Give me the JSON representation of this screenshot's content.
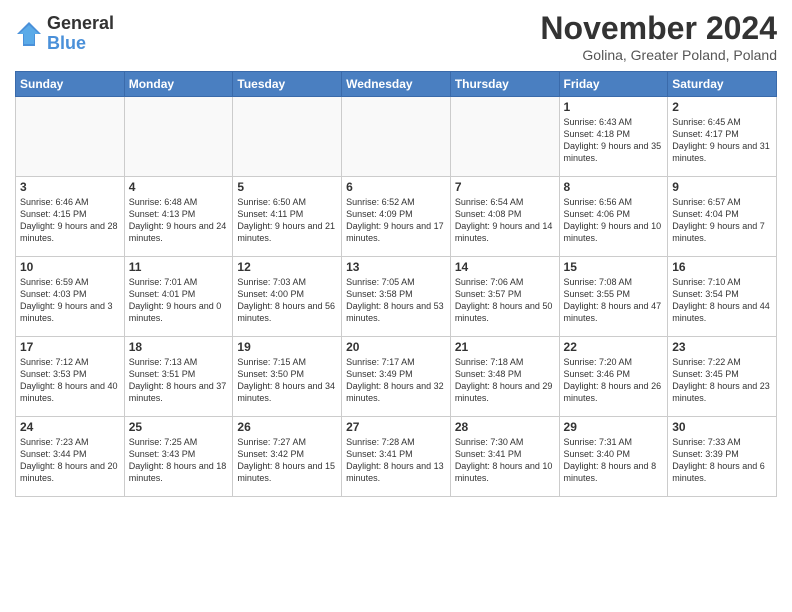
{
  "logo": {
    "general": "General",
    "blue": "Blue"
  },
  "title": "November 2024",
  "subtitle": "Golina, Greater Poland, Poland",
  "days_header": [
    "Sunday",
    "Monday",
    "Tuesday",
    "Wednesday",
    "Thursday",
    "Friday",
    "Saturday"
  ],
  "weeks": [
    [
      {
        "num": "",
        "info": ""
      },
      {
        "num": "",
        "info": ""
      },
      {
        "num": "",
        "info": ""
      },
      {
        "num": "",
        "info": ""
      },
      {
        "num": "",
        "info": ""
      },
      {
        "num": "1",
        "info": "Sunrise: 6:43 AM\nSunset: 4:18 PM\nDaylight: 9 hours\nand 35 minutes."
      },
      {
        "num": "2",
        "info": "Sunrise: 6:45 AM\nSunset: 4:17 PM\nDaylight: 9 hours\nand 31 minutes."
      }
    ],
    [
      {
        "num": "3",
        "info": "Sunrise: 6:46 AM\nSunset: 4:15 PM\nDaylight: 9 hours\nand 28 minutes."
      },
      {
        "num": "4",
        "info": "Sunrise: 6:48 AM\nSunset: 4:13 PM\nDaylight: 9 hours\nand 24 minutes."
      },
      {
        "num": "5",
        "info": "Sunrise: 6:50 AM\nSunset: 4:11 PM\nDaylight: 9 hours\nand 21 minutes."
      },
      {
        "num": "6",
        "info": "Sunrise: 6:52 AM\nSunset: 4:09 PM\nDaylight: 9 hours\nand 17 minutes."
      },
      {
        "num": "7",
        "info": "Sunrise: 6:54 AM\nSunset: 4:08 PM\nDaylight: 9 hours\nand 14 minutes."
      },
      {
        "num": "8",
        "info": "Sunrise: 6:56 AM\nSunset: 4:06 PM\nDaylight: 9 hours\nand 10 minutes."
      },
      {
        "num": "9",
        "info": "Sunrise: 6:57 AM\nSunset: 4:04 PM\nDaylight: 9 hours\nand 7 minutes."
      }
    ],
    [
      {
        "num": "10",
        "info": "Sunrise: 6:59 AM\nSunset: 4:03 PM\nDaylight: 9 hours\nand 3 minutes."
      },
      {
        "num": "11",
        "info": "Sunrise: 7:01 AM\nSunset: 4:01 PM\nDaylight: 9 hours\nand 0 minutes."
      },
      {
        "num": "12",
        "info": "Sunrise: 7:03 AM\nSunset: 4:00 PM\nDaylight: 8 hours\nand 56 minutes."
      },
      {
        "num": "13",
        "info": "Sunrise: 7:05 AM\nSunset: 3:58 PM\nDaylight: 8 hours\nand 53 minutes."
      },
      {
        "num": "14",
        "info": "Sunrise: 7:06 AM\nSunset: 3:57 PM\nDaylight: 8 hours\nand 50 minutes."
      },
      {
        "num": "15",
        "info": "Sunrise: 7:08 AM\nSunset: 3:55 PM\nDaylight: 8 hours\nand 47 minutes."
      },
      {
        "num": "16",
        "info": "Sunrise: 7:10 AM\nSunset: 3:54 PM\nDaylight: 8 hours\nand 44 minutes."
      }
    ],
    [
      {
        "num": "17",
        "info": "Sunrise: 7:12 AM\nSunset: 3:53 PM\nDaylight: 8 hours\nand 40 minutes."
      },
      {
        "num": "18",
        "info": "Sunrise: 7:13 AM\nSunset: 3:51 PM\nDaylight: 8 hours\nand 37 minutes."
      },
      {
        "num": "19",
        "info": "Sunrise: 7:15 AM\nSunset: 3:50 PM\nDaylight: 8 hours\nand 34 minutes."
      },
      {
        "num": "20",
        "info": "Sunrise: 7:17 AM\nSunset: 3:49 PM\nDaylight: 8 hours\nand 32 minutes."
      },
      {
        "num": "21",
        "info": "Sunrise: 7:18 AM\nSunset: 3:48 PM\nDaylight: 8 hours\nand 29 minutes."
      },
      {
        "num": "22",
        "info": "Sunrise: 7:20 AM\nSunset: 3:46 PM\nDaylight: 8 hours\nand 26 minutes."
      },
      {
        "num": "23",
        "info": "Sunrise: 7:22 AM\nSunset: 3:45 PM\nDaylight: 8 hours\nand 23 minutes."
      }
    ],
    [
      {
        "num": "24",
        "info": "Sunrise: 7:23 AM\nSunset: 3:44 PM\nDaylight: 8 hours\nand 20 minutes."
      },
      {
        "num": "25",
        "info": "Sunrise: 7:25 AM\nSunset: 3:43 PM\nDaylight: 8 hours\nand 18 minutes."
      },
      {
        "num": "26",
        "info": "Sunrise: 7:27 AM\nSunset: 3:42 PM\nDaylight: 8 hours\nand 15 minutes."
      },
      {
        "num": "27",
        "info": "Sunrise: 7:28 AM\nSunset: 3:41 PM\nDaylight: 8 hours\nand 13 minutes."
      },
      {
        "num": "28",
        "info": "Sunrise: 7:30 AM\nSunset: 3:41 PM\nDaylight: 8 hours\nand 10 minutes."
      },
      {
        "num": "29",
        "info": "Sunrise: 7:31 AM\nSunset: 3:40 PM\nDaylight: 8 hours\nand 8 minutes."
      },
      {
        "num": "30",
        "info": "Sunrise: 7:33 AM\nSunset: 3:39 PM\nDaylight: 8 hours\nand 6 minutes."
      }
    ]
  ]
}
